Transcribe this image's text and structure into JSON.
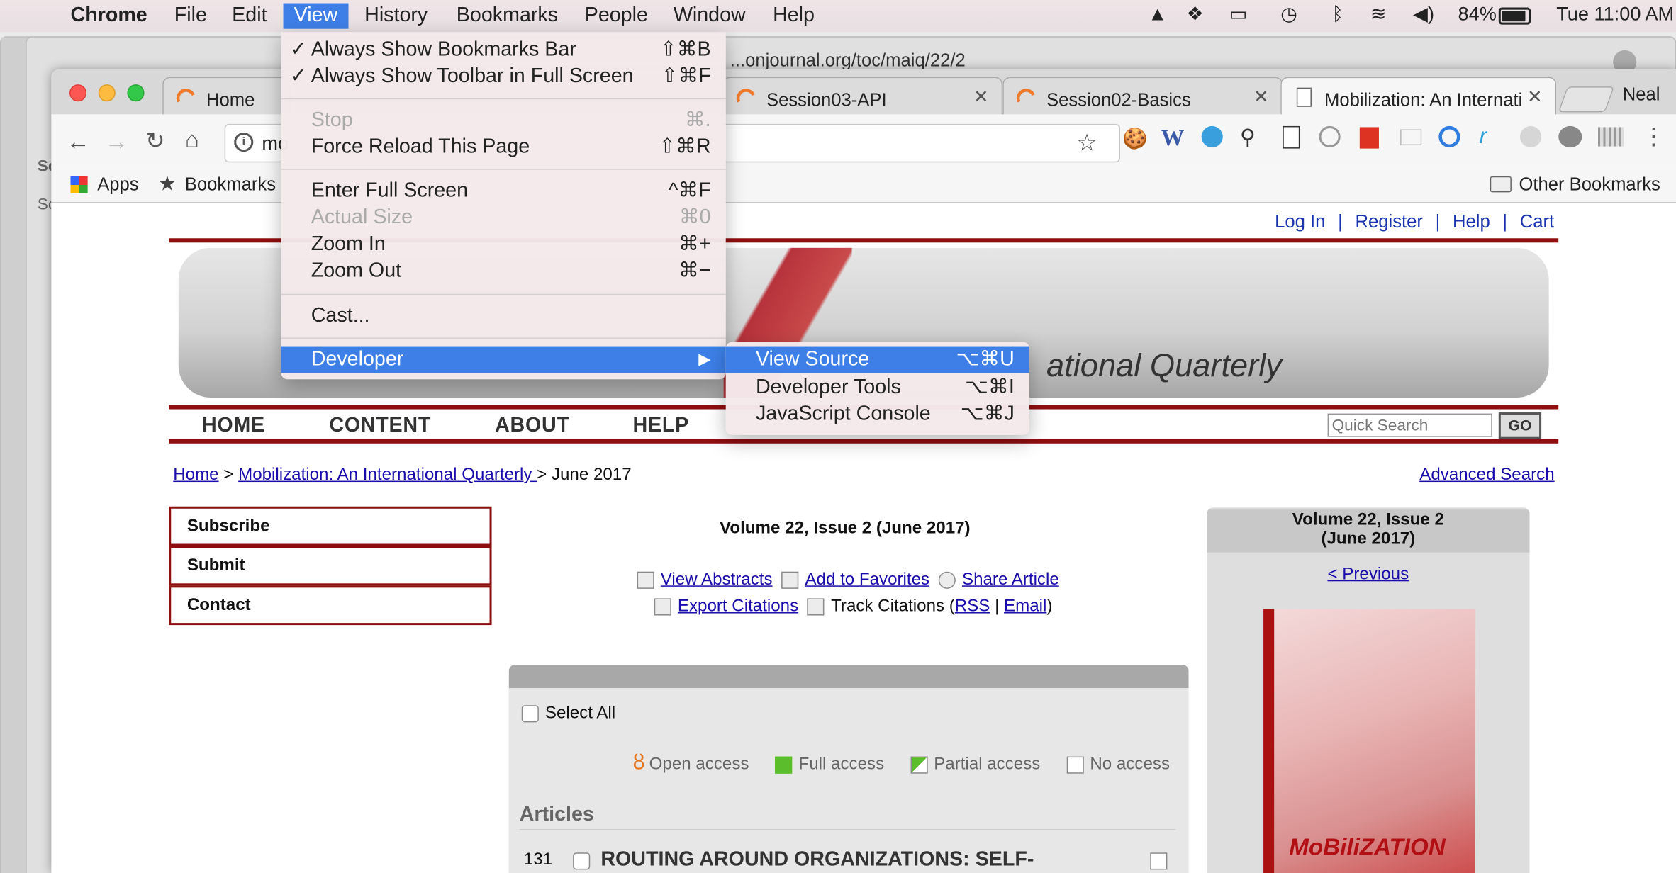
{
  "menubar": {
    "app": "Chrome",
    "items": [
      "File",
      "Edit",
      "View",
      "History",
      "Bookmarks",
      "People",
      "Window",
      "Help"
    ],
    "battery": "84%",
    "clock": "Tue 11:00 AM"
  },
  "background_url": "...onjournal.org/toc/maiq/22/2",
  "tabs": [
    {
      "label": "Home"
    },
    {
      "label": "Session03-API"
    },
    {
      "label": "Session02-Basics"
    },
    {
      "label": "Mobilization: An Internati"
    }
  ],
  "profile_name": "Neal",
  "omnibox_text": "mo",
  "bookmarks": {
    "apps": "Apps",
    "bookmarks": "Bookmarks",
    "other": "Other Bookmarks"
  },
  "view_menu": {
    "always_bookmarks": {
      "label": "Always Show Bookmarks Bar",
      "shortcut": "⇧⌘B"
    },
    "always_toolbar": {
      "label": "Always Show Toolbar in Full Screen",
      "shortcut": "⇧⌘F"
    },
    "stop": {
      "label": "Stop",
      "shortcut": "⌘."
    },
    "force_reload": {
      "label": "Force Reload This Page",
      "shortcut": "⇧⌘R"
    },
    "full_screen": {
      "label": "Enter Full Screen",
      "shortcut": "^⌘F"
    },
    "actual_size": {
      "label": "Actual Size",
      "shortcut": "⌘0"
    },
    "zoom_in": {
      "label": "Zoom In",
      "shortcut": "⌘+"
    },
    "zoom_out": {
      "label": "Zoom Out",
      "shortcut": "⌘−"
    },
    "cast": {
      "label": "Cast..."
    },
    "developer": {
      "label": "Developer"
    }
  },
  "developer_menu": {
    "view_source": {
      "label": "View Source",
      "shortcut": "⌥⌘U"
    },
    "dev_tools": {
      "label": "Developer Tools",
      "shortcut": "⌥⌘I"
    },
    "js_console": {
      "label": "JavaScript Console",
      "shortcut": "⌥⌘J"
    }
  },
  "page": {
    "top_links": [
      "Log In",
      "Register",
      "Help",
      "Cart"
    ],
    "banner_text": "ational Quarterly",
    "nav": [
      "HOME",
      "CONTENT",
      "ABOUT",
      "HELP"
    ],
    "search_placeholder": "Quick Search",
    "search_go": "GO",
    "breadcrumb": {
      "home": "Home",
      "journal": "Mobilization: An International Quarterly ",
      "current": "June 2017"
    },
    "advanced_search": "Advanced Search",
    "side_links": [
      "Subscribe",
      "Submit",
      "Contact"
    ],
    "issue_title": "Volume 22, Issue 2 (June 2017)",
    "actions": {
      "view_abstracts": "View Abstracts",
      "add_favorites": "Add to Favorites",
      "share": "Share Article",
      "export": "Export Citations",
      "track": "Track Citations (",
      "rss": "RSS",
      "email": "Email"
    },
    "select_all": "Select All",
    "legend": {
      "open": "Open access",
      "full": "Full access",
      "partial": "Partial access",
      "none": "No access"
    },
    "articles_heading": "Articles",
    "article": {
      "page": "131",
      "title": "ROUTING AROUND ORGANIZATIONS: SELF-"
    },
    "right_box": {
      "line1": "Volume 22, Issue 2",
      "line2": "(June 2017)",
      "previous": "< Previous"
    }
  },
  "colors": {
    "accent": "#3d7fe7",
    "journal_red": "#8e0f10",
    "link": "#1a0dab"
  }
}
